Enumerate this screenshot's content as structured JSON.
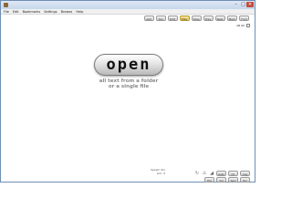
{
  "menu": [
    "File",
    "Edit",
    "Bookmarks",
    "Settings",
    "Browse",
    "Help"
  ],
  "toolbar": {
    "buttons": [
      "Add",
      "Del",
      "Edit",
      "Play",
      "Stop",
      "Prev",
      "Next",
      "Mark",
      "Find"
    ],
    "accent_index": 3,
    "sub_label": "AB 60"
  },
  "main": {
    "open_label": "open",
    "hint_line1": "all text from a folder",
    "hint_line2": "or a single file"
  },
  "status": {
    "line1": "Speed: Slo",
    "line2": "Lim: 0"
  },
  "bottom_buttons_row1": [
    "Auto",
    "Clr",
    "Cpy"
  ],
  "bottom_buttons_row2": [
    "Pos",
    "Vol",
    "Spd",
    "Voc"
  ],
  "colors": {
    "accent": "#e6c659",
    "close": "#c44a3c",
    "hint": "#8a8a8a"
  }
}
